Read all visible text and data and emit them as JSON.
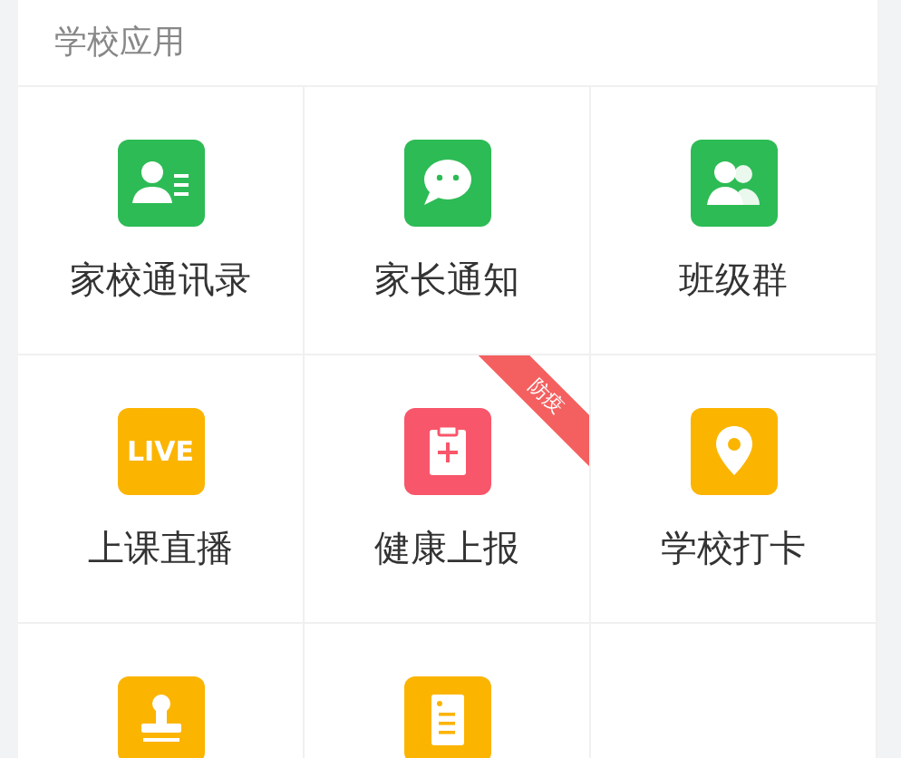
{
  "section": {
    "title": "学校应用"
  },
  "apps": [
    {
      "label": "家校通讯录",
      "kind": "contacts",
      "color": "#2dbb55"
    },
    {
      "label": "家长通知",
      "kind": "chat",
      "color": "#2dbb55"
    },
    {
      "label": "班级群",
      "kind": "group",
      "color": "#2dbb55"
    },
    {
      "label": "上课直播",
      "kind": "live",
      "color": "#fbb400",
      "icon_text": "LIVE"
    },
    {
      "label": "健康上报",
      "kind": "clipboard",
      "color": "#f8566a",
      "ribbon": "防疫"
    },
    {
      "label": "学校打卡",
      "kind": "pin",
      "color": "#fbb400"
    },
    {
      "kind": "stamp",
      "color": "#fbb400"
    },
    {
      "kind": "document",
      "color": "#fbb400"
    }
  ]
}
